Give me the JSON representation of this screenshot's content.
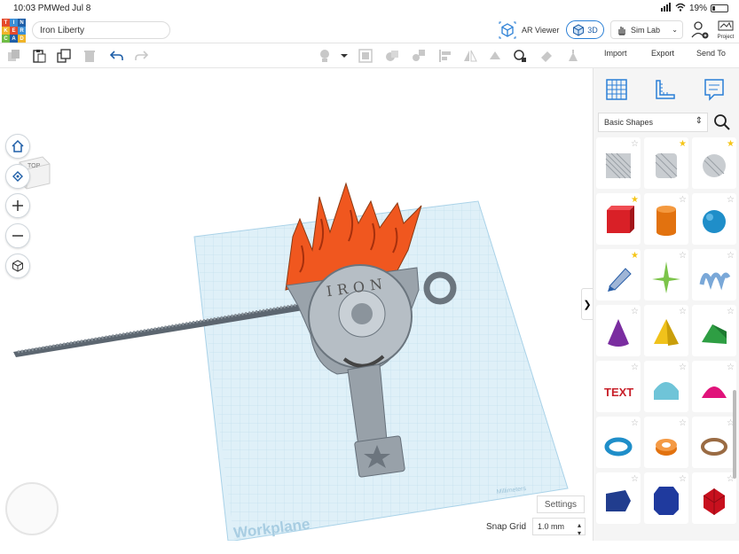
{
  "status": {
    "time": "10:03 PM",
    "date": "Wed Jul 8",
    "battery": "19%"
  },
  "app": {
    "logo_letters": [
      "T",
      "I",
      "N",
      "K",
      "E",
      "R",
      "C",
      "A",
      "D"
    ],
    "project_title": "Iron Liberty",
    "ar_viewer": "AR Viewer",
    "view_3d": "3D",
    "sim_lab": "Sim Lab",
    "project_label": "Project"
  },
  "toolbar": {
    "import": "Import",
    "export": "Export",
    "send_to": "Send To"
  },
  "viewport": {
    "viewcube_face": "TOP",
    "workplane_label": "Workplane",
    "units_label": "Millimeters",
    "settings": "Settings",
    "snap_label": "Snap Grid",
    "snap_value": "1.0 mm",
    "model_text": "IRON"
  },
  "panel": {
    "category": "Basic Shapes",
    "shapes": [
      {
        "name": "box-hole",
        "starred": false
      },
      {
        "name": "cylinder-hole",
        "starred": true
      },
      {
        "name": "sphere-hole",
        "starred": true
      },
      {
        "name": "box",
        "starred": true
      },
      {
        "name": "cylinder",
        "starred": false
      },
      {
        "name": "sphere",
        "starred": false
      },
      {
        "name": "scribble",
        "starred": true
      },
      {
        "name": "shape-generator",
        "starred": false
      },
      {
        "name": "text-squiggle",
        "starred": false
      },
      {
        "name": "cone",
        "starred": false
      },
      {
        "name": "pyramid",
        "starred": false
      },
      {
        "name": "roof",
        "starred": false
      },
      {
        "name": "text",
        "starred": false
      },
      {
        "name": "half-cylinder",
        "starred": false
      },
      {
        "name": "half-sphere",
        "starred": false
      },
      {
        "name": "torus",
        "starred": false
      },
      {
        "name": "tube",
        "starred": false
      },
      {
        "name": "ring",
        "starred": false
      },
      {
        "name": "polygon",
        "starred": false
      },
      {
        "name": "hexagonal-prism",
        "starred": false
      },
      {
        "name": "icosahedron",
        "starred": false
      }
    ],
    "colors": {
      "accent": "#2a7fd6",
      "star": "#f5c518"
    }
  }
}
